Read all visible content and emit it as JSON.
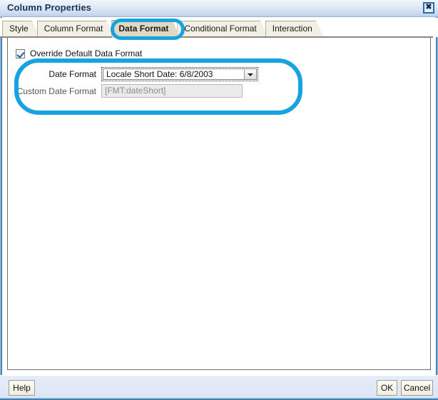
{
  "window": {
    "title": "Column Properties",
    "close_icon": "close-icon",
    "close_glyph": "✖"
  },
  "tabs": [
    {
      "label": "Style",
      "active": false
    },
    {
      "label": "Column Format",
      "active": false
    },
    {
      "label": "Data Format",
      "active": true
    },
    {
      "label": "Conditional Format",
      "active": false
    },
    {
      "label": "Interaction",
      "active": false
    }
  ],
  "content": {
    "override_checkbox": {
      "label": "Override Default Data Format",
      "checked": true
    },
    "fields": [
      {
        "label": "Date Format",
        "type": "select",
        "value": "Locale Short Date: 6/8/2003",
        "arrow_icon": "chevron-down-icon",
        "disabled": false
      },
      {
        "label": "Custom Date Format",
        "type": "text",
        "value": "[FMT:dateShort]",
        "disabled": true
      }
    ]
  },
  "annotations": {
    "color": "#17a2e0",
    "tab_highlight_target": "Data Format",
    "field_highlight_target": "Date Format fields"
  },
  "footer": {
    "help_label": "Help",
    "ok_label": "OK",
    "cancel_label": "Cancel"
  }
}
